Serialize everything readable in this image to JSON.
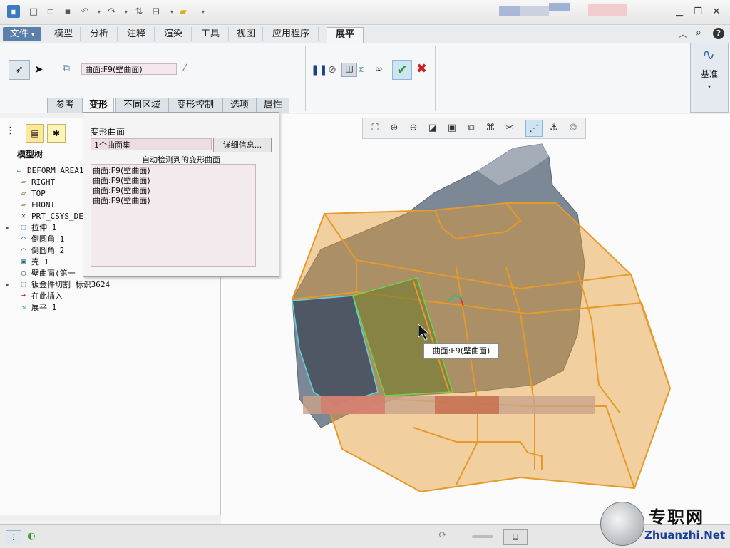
{
  "menu": {
    "file": "文件",
    "tabs": [
      "模型",
      "分析",
      "注释",
      "渲染",
      "工具",
      "视图",
      "应用程序"
    ],
    "active_tab": "展平"
  },
  "ribbon": {
    "surface_field": "曲面:F9(壁曲面)",
    "datum_label": "基准",
    "subtabs": [
      "参考",
      "变形",
      "不同区域",
      "变形控制",
      "选项",
      "属性"
    ]
  },
  "popup": {
    "title": "变形曲面",
    "collection_value": "1个曲面集",
    "details_button": "详细信息...",
    "auto_label": "自动检测到的变形曲面",
    "items": [
      "曲面:F9(壁曲面)",
      "曲面:F9(壁曲面)",
      "曲面:F9(壁曲面)",
      "曲面:F9(壁曲面)"
    ]
  },
  "tree": {
    "title": "模型树",
    "items": [
      {
        "label": "DEFORM_AREA1.PR",
        "icon": "part-icon",
        "expand": false
      },
      {
        "label": "RIGHT",
        "icon": "datum-plane-icon",
        "expand": false
      },
      {
        "label": "TOP",
        "icon": "datum-plane-icon",
        "expand": false
      },
      {
        "label": "FRONT",
        "icon": "datum-plane-icon",
        "expand": false
      },
      {
        "label": "PRT_CSYS_DE",
        "icon": "csys-icon",
        "expand": false
      },
      {
        "label": "拉伸 1",
        "icon": "extrude-icon",
        "expand": true
      },
      {
        "label": "倒圆角 1",
        "icon": "round-icon",
        "expand": false
      },
      {
        "label": "倒圆角 2",
        "icon": "round-icon",
        "expand": false
      },
      {
        "label": "壳 1",
        "icon": "shell-icon",
        "expand": false
      },
      {
        "label": "壁曲面(第一",
        "icon": "wall-icon",
        "expand": false
      },
      {
        "label": "钣金件切割 标识3624",
        "icon": "cut-icon",
        "expand": true
      },
      {
        "label": "在此插入",
        "icon": "insert-arrow-icon",
        "expand": false
      },
      {
        "label": "展平 1",
        "icon": "flatten-icon",
        "expand": false
      }
    ]
  },
  "viewport": {
    "tooltip": "曲面:F9(壁曲面)"
  },
  "watermark": {
    "name": "专职网",
    "url": "Zhuanzhi.Net"
  },
  "colors": {
    "accent_orange": "#e59a2c",
    "part_gray": "#7d8896",
    "confirm_green": "#2a9a2a",
    "cancel_red": "#cc2222"
  }
}
